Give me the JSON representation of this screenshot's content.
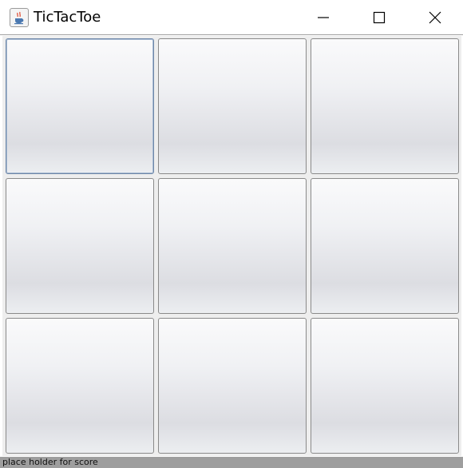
{
  "window": {
    "title": "TicTacToe",
    "icon": "java-cup-icon",
    "controls": [
      "minimize-icon",
      "maximize-icon",
      "close-icon"
    ]
  },
  "board": {
    "cells": [
      "",
      "",
      "",
      "",
      "",
      "",
      "",
      "",
      ""
    ]
  },
  "status": {
    "text": "place holder for score"
  }
}
